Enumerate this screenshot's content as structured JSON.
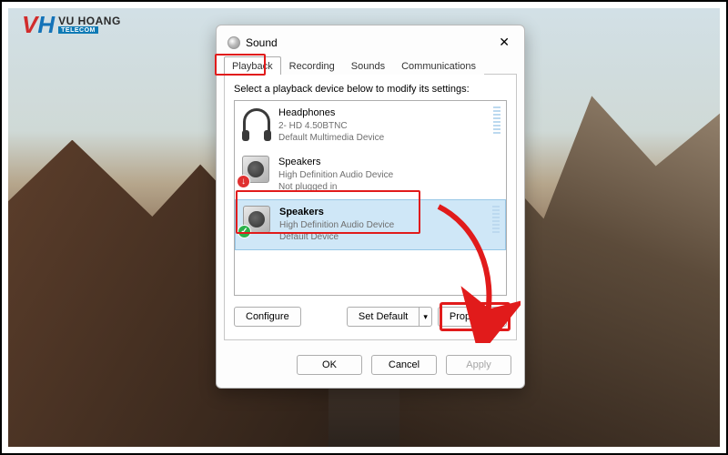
{
  "logo": {
    "line1": "VU HOANG",
    "line2": "TELECOM"
  },
  "dialog": {
    "title": "Sound",
    "tabs": [
      "Playback",
      "Recording",
      "Sounds",
      "Communications"
    ],
    "active_tab": 0,
    "instruction": "Select a playback device below to modify its settings:",
    "devices": [
      {
        "name": "Headphones",
        "sub1": "2- HD 4.50BTNC",
        "sub2": "Default Multimedia Device",
        "icon": "headphones",
        "badge": null
      },
      {
        "name": "Speakers",
        "sub1": "High Definition Audio Device",
        "sub2": "Not plugged in",
        "icon": "speaker",
        "badge": "down"
      },
      {
        "name": "Speakers",
        "sub1": "High Definition Audio Device",
        "sub2": "Default Device",
        "icon": "speaker",
        "badge": "check",
        "selected": true
      }
    ],
    "buttons": {
      "configure": "Configure",
      "setdefault": "Set Default",
      "properties": "Properties",
      "ok": "OK",
      "cancel": "Cancel",
      "apply": "Apply"
    }
  }
}
